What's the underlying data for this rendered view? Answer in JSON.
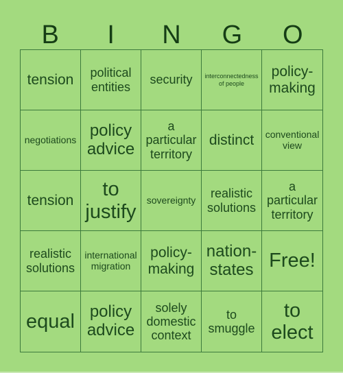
{
  "header": {
    "letters": [
      "B",
      "I",
      "N",
      "G",
      "O"
    ]
  },
  "board": {
    "rows": [
      [
        "tension",
        "political entities",
        "security",
        "interconnectedness of people",
        "policy-making"
      ],
      [
        "negotiations",
        "policy advice",
        "a particular territory",
        "distinct",
        "conventional view"
      ],
      [
        "tension",
        "to justify",
        "sovereignty",
        "realistic solutions",
        "a particular territory"
      ],
      [
        "realistic solutions",
        "international migration",
        "policy-making",
        "nation-states",
        "Free!"
      ],
      [
        "equal",
        "policy advice",
        "solely domestic context",
        "to smuggle",
        "to elect"
      ]
    ],
    "free_space_label": "Free!"
  },
  "colors": {
    "background": "#a3da7f",
    "grid_line": "#3c7a3c",
    "text": "#1d4a1d"
  }
}
